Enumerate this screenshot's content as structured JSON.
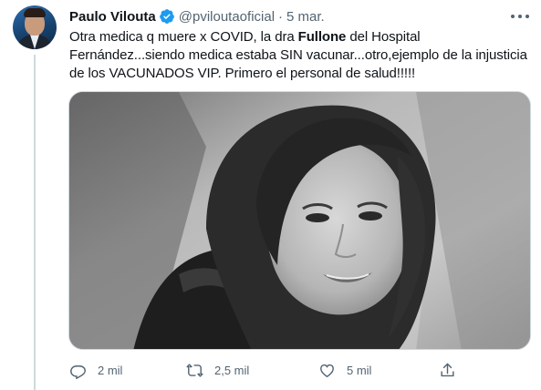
{
  "tweet": {
    "author_name": "Paulo Vilouta",
    "handle": "@pviloutaoficial",
    "separator": "·",
    "date": "5 mar.",
    "text_part1": "Otra medica q muere x COVID, la dra ",
    "text_bold": "Fullone",
    "text_part2": " del Hospital Fernández...siendo medica estaba SIN vacunar...otro,ejemplo de la injusticia de los VACUNADOS VIP. Primero el personal de salud!!!!!",
    "verified_icon": "verified-badge-icon",
    "accent_color": "#1d9bf0"
  },
  "actions": {
    "reply": {
      "icon": "reply-icon",
      "count": "2 mil"
    },
    "retweet": {
      "icon": "retweet-icon",
      "count": "2,5 mil"
    },
    "like": {
      "icon": "heart-icon",
      "count": "5 mil"
    },
    "share": {
      "icon": "share-icon"
    }
  },
  "colors": {
    "text": "#0f1419",
    "secondary": "#536471",
    "border": "#cfd9de"
  }
}
